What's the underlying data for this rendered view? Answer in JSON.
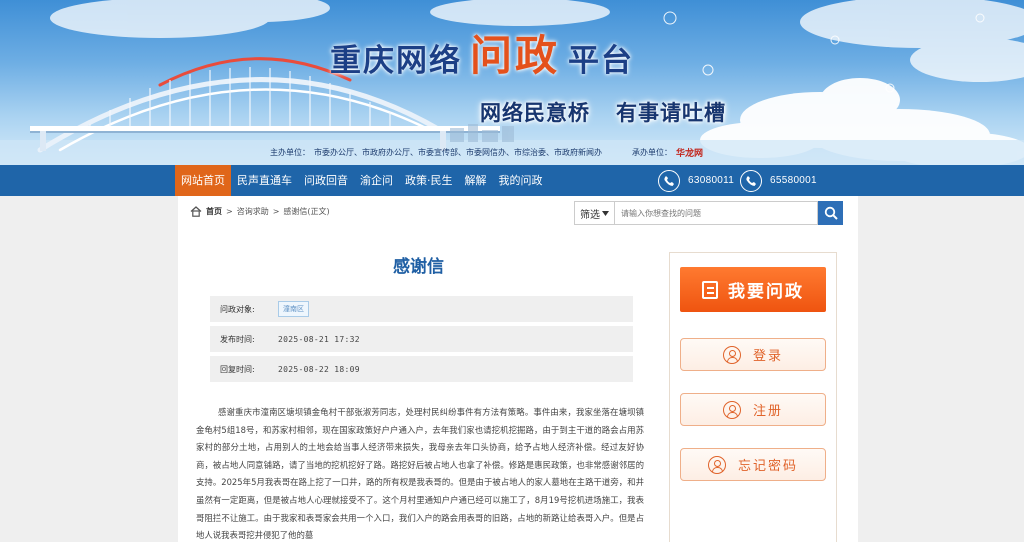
{
  "banner": {
    "title_part1": "重庆网络",
    "title_part2": "问政",
    "title_part3": "平台",
    "slogan_left": "网络民意桥",
    "slogan_right": "有事请吐槽",
    "sponsor_label": "主办单位：",
    "sponsor_text": "市委办公厅、市政府办公厅、市委宣传部、市委网信办、市综治委、市政府新闻办",
    "organizer_label": "承办单位：",
    "organizer_text": "华龙网"
  },
  "nav": {
    "items": [
      "网站首页",
      "民声直通车",
      "问政回音",
      "渝企问",
      "政策·民生",
      "解解",
      "我的问政"
    ],
    "active_index": 0,
    "hotline_1": "63080011",
    "hotline_2": "65580001",
    "bg_color": "#1f65a9",
    "active_color": "#e0661a"
  },
  "breadcrumb": {
    "home": "首页",
    "level2": "咨询求助",
    "level3": "感谢信(正文)",
    "sep": ">"
  },
  "search": {
    "filter_label": "筛选",
    "placeholder": "请输入你想查找的问题"
  },
  "article": {
    "title": "感谢信",
    "meta": {
      "target_label": "问政对象:",
      "target_value": "潼南区",
      "published_label": "发布时间:",
      "published_value": "2025-08-21 17:32",
      "replied_label": "回复时间:",
      "replied_value": "2025-08-22 18:09"
    },
    "body": "感谢重庆市潼南区塘坝镇金龟村干部张淑芳同志，处理村民纠纷事件有方法有策略。事件由来，我家坐落在塘坝镇金龟村5组18号，和苏家村相邻，现在国家政策好户户通入户，去年我们家也请挖机挖掘路，由于到主干道的路会占用苏家村的部分土地，占用别人的土地会给当事人经济带来损失，我母亲去年口头协商，给予占地人经济补偿。经过友好协商，被占地人同意铺路，请了当地的挖机挖好了路。路挖好后被占地人也拿了补偿。修路是惠民政策，也非常感谢邻居的支持。2025年5月我表哥在路上挖了一口井，路的所有权是我表哥的。但是由于被占地人的家人墓地在主路干道旁，和井虽然有一定距离，但是被占地人心理就接受不了。这个月村里通知户户通已经可以施工了，8月19号挖机进场施工，我表哥阻拦不让施工。由于我家和表哥家会共用一个入口，我们入户的路会用表哥的旧路，占地的新路让给表哥入户。但是占地人说我表哥挖井侵犯了他的墓"
  },
  "sidebar": {
    "ask_label": "我要问政",
    "login_label": "登录",
    "register_label": "注册",
    "forgot_label": "忘记密码",
    "accent_color": "#ef5a17"
  }
}
